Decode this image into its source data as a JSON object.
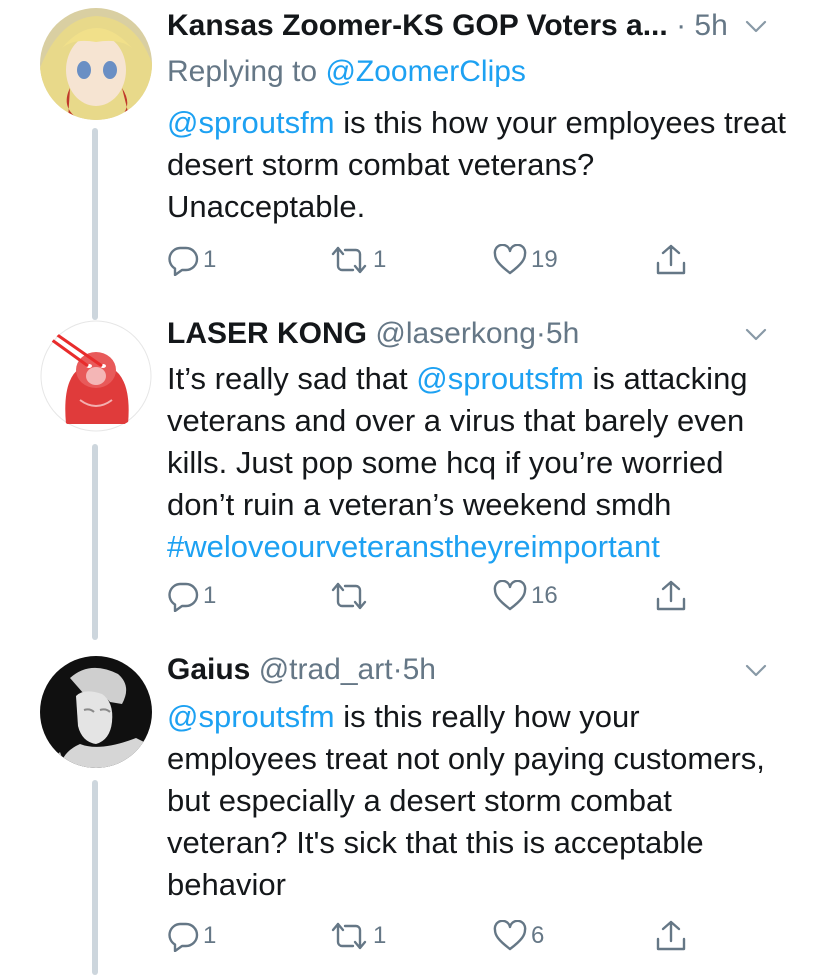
{
  "tweets": [
    {
      "name": "Kansas Zoomer-KS GOP Voters a...",
      "handle": "",
      "dot": "·",
      "time": "5h",
      "reply_prefix": "Replying to ",
      "reply_to": "@ZoomerClips",
      "mention": "@sproutsfm",
      "text_after_mention": " is this how your employees treat desert storm combat veterans? Unacceptable.",
      "hashtag": "",
      "replies": "1",
      "retweets": "1",
      "likes": "19"
    },
    {
      "name": "LASER KONG",
      "handle": "@laserkong",
      "dot": "·",
      "time": "5h",
      "reply_prefix": "",
      "reply_to": "",
      "text_before_mention": "It’s really sad that ",
      "mention": "@sproutsfm",
      "text_after_mention": " is attacking veterans and over a virus that barely even kills. Just pop some hcq if you’re worried don’t ruin a veteran’s weekend smdh",
      "hashtag": "#weloveourveteranstheyreimportant",
      "replies": "1",
      "retweets": "",
      "likes": "16"
    },
    {
      "name": "Gaius",
      "handle": "@trad_art",
      "dot": "·",
      "time": "5h",
      "reply_prefix": "",
      "reply_to": "",
      "mention": "@sproutsfm",
      "text_after_mention": " is this really how your employees treat not only paying customers, but especially a desert storm combat veteran? It's sick that this is acceptable behavior",
      "hashtag": "",
      "replies": "1",
      "retweets": "1",
      "likes": "6"
    }
  ],
  "colors": {
    "link": "#1da1f2",
    "muted": "#657786",
    "text": "#14171a",
    "thread_line": "#cdd6dd"
  },
  "icons": [
    "reply-icon",
    "retweet-icon",
    "like-icon",
    "share-icon",
    "chevron-down-icon"
  ]
}
